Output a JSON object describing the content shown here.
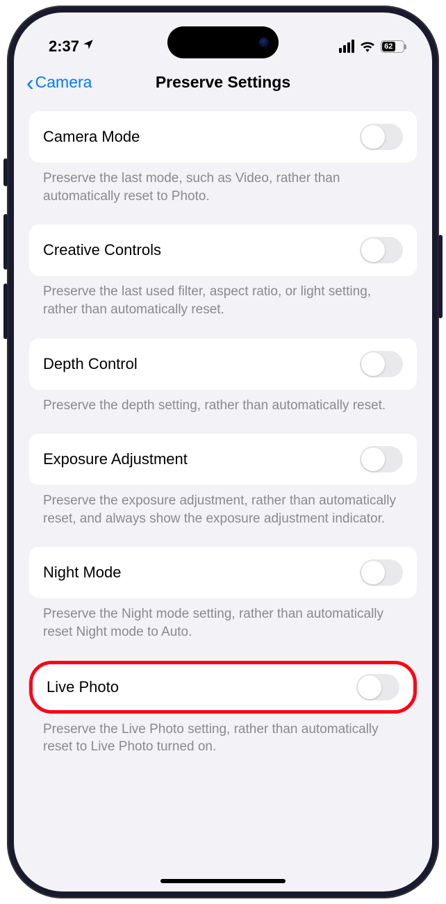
{
  "status": {
    "time": "2:37",
    "battery_pct": "62",
    "battery_fill_width": "62%"
  },
  "nav": {
    "back_label": "Camera",
    "title": "Preserve Settings"
  },
  "settings": [
    {
      "label": "Camera Mode",
      "desc": "Preserve the last mode, such as Video, rather than automatically reset to Photo."
    },
    {
      "label": "Creative Controls",
      "desc": "Preserve the last used filter, aspect ratio, or light setting, rather than automatically reset."
    },
    {
      "label": "Depth Control",
      "desc": "Preserve the depth setting, rather than automatically reset."
    },
    {
      "label": "Exposure Adjustment",
      "desc": "Preserve the exposure adjustment, rather than automatically reset, and always show the exposure adjustment indicator."
    },
    {
      "label": "Night Mode",
      "desc": "Preserve the Night mode setting, rather than automatically reset Night mode to Auto."
    },
    {
      "label": "Live Photo",
      "desc": "Preserve the Live Photo setting, rather than automatically reset to Live Photo turned on."
    }
  ]
}
